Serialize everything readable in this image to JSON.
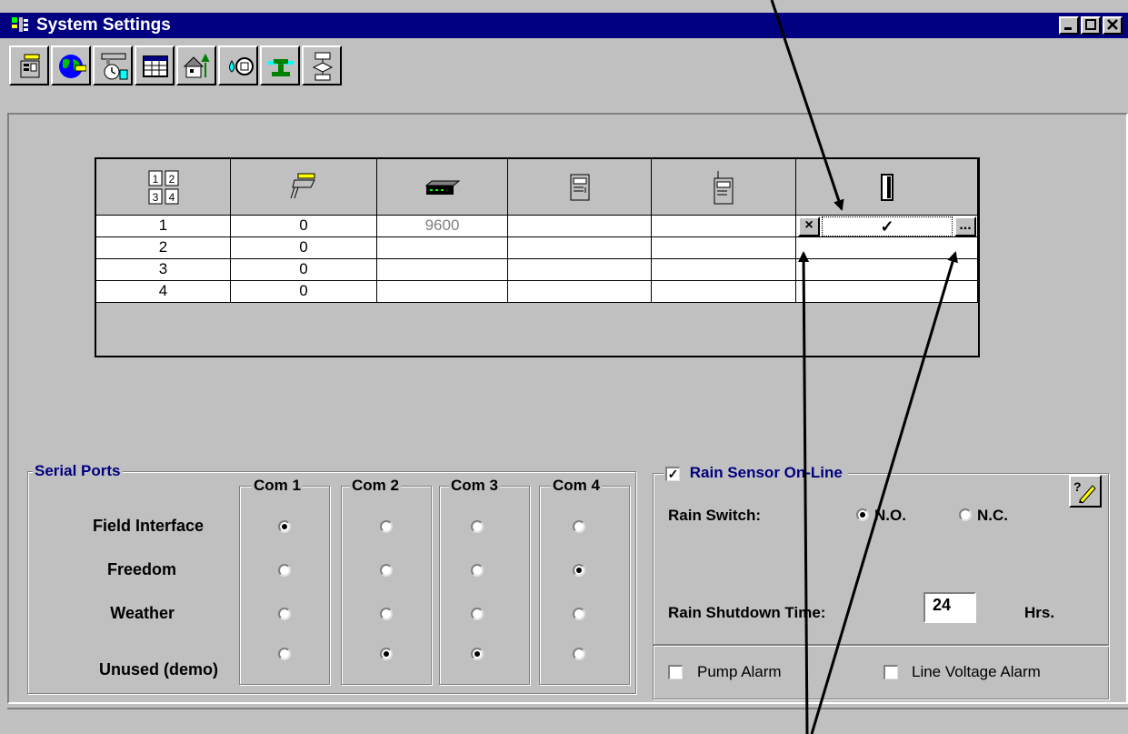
{
  "window": {
    "title": "System Settings",
    "controls": [
      "minimize",
      "maximize",
      "close"
    ]
  },
  "toolbar": {
    "buttons": [
      "controller-icon",
      "globe-icon",
      "schedule-clock-icon",
      "table-icon",
      "house-icon",
      "water-meter-icon",
      "pump-icon",
      "flowchart-icon"
    ]
  },
  "grid": {
    "columns": [
      "numbers-icon",
      "field-interface-icon",
      "modem-icon",
      "freedom-icon",
      "remote-icon",
      "sensor-icon"
    ],
    "rows": [
      {
        "n": "1",
        "c1": "0",
        "c2": "9600",
        "c3": "",
        "c4": ""
      },
      {
        "n": "2",
        "c1": "0",
        "c2": "",
        "c3": "",
        "c4": ""
      },
      {
        "n": "3",
        "c1": "0",
        "c2": "",
        "c3": "",
        "c4": ""
      },
      {
        "n": "4",
        "c1": "0",
        "c2": "",
        "c3": "",
        "c4": ""
      }
    ],
    "editor": {
      "cancel": "×",
      "check": "✓",
      "more": "..."
    }
  },
  "serial_ports": {
    "title": "Serial Ports",
    "ports": [
      "Com 1",
      "Com 2",
      "Com 3",
      "Com 4"
    ],
    "rows": [
      {
        "label": "Field Interface",
        "selected": 0
      },
      {
        "label": "Freedom",
        "selected": 3
      },
      {
        "label": "Weather",
        "selected": -1
      },
      {
        "label": "Unused (demo)",
        "selected": [
          1,
          2
        ]
      }
    ]
  },
  "rain": {
    "online_label": "Rain Sensor On-Line",
    "online_checked": true,
    "switch_label": "Rain Switch:",
    "no_label": "N.O.",
    "nc_label": "N.C.",
    "switch_selected": "N.O.",
    "shutdown_label": "Rain Shutdown Time:",
    "shutdown_value": "24",
    "shutdown_unit": "Hrs.",
    "help_icon": "help-pencil-icon"
  },
  "alarms": {
    "pump": {
      "label": "Pump Alarm",
      "checked": false
    },
    "line_voltage": {
      "label": "Line Voltage Alarm",
      "checked": false
    }
  }
}
